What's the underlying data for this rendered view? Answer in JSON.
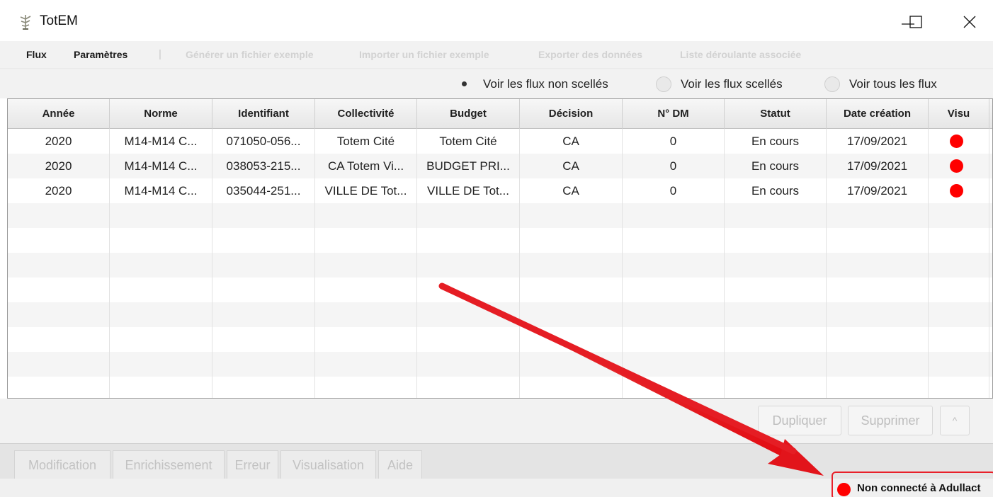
{
  "window": {
    "title": "TotEM",
    "app_icon": "tree-icon",
    "minimize_icon": "minimize-icon",
    "maximize_icon": "maximize-icon",
    "close_icon": "close-icon"
  },
  "menubar": {
    "items": [
      {
        "label": "Flux",
        "enabled": true
      },
      {
        "label": "Paramètres",
        "enabled": true
      },
      {
        "label": "Générer un fichier exemple",
        "enabled": false
      },
      {
        "label": "Importer un fichier exemple",
        "enabled": false
      },
      {
        "label": "Exporter des données",
        "enabled": false
      },
      {
        "label": "Liste déroulante associée",
        "enabled": false
      }
    ],
    "separator": "|"
  },
  "filters": {
    "options": [
      {
        "label": "Voir les flux non scellés",
        "checked": true
      },
      {
        "label": "Voir les flux scellés",
        "checked": false
      },
      {
        "label": "Voir tous les flux",
        "checked": false
      }
    ]
  },
  "table": {
    "columns": [
      "Année",
      "Norme",
      "Identifiant",
      "Collectivité",
      "Budget",
      "Décision",
      "N° DM",
      "Statut",
      "Date création",
      "Visu"
    ],
    "rows": [
      [
        "2020",
        "M14-M14 C...",
        "071050-056...",
        "Totem Cité",
        "Totem Cité",
        "CA",
        "0",
        "En cours",
        "17/09/2021",
        "red-dot"
      ],
      [
        "2020",
        "M14-M14 C...",
        "038053-215...",
        "CA Totem Vi...",
        "BUDGET PRI...",
        "CA",
        "0",
        "En cours",
        "17/09/2021",
        "red-dot"
      ],
      [
        "2020",
        "M14-M14 C...",
        "035044-251...",
        "VILLE DE Tot...",
        "VILLE DE Tot...",
        "CA",
        "0",
        "En cours",
        "17/09/2021",
        "red-dot"
      ]
    ],
    "empty_rows": 8
  },
  "actions": {
    "duplicate_label": "Dupliquer",
    "delete_label": "Supprimer",
    "up_label": "^"
  },
  "tabs": [
    "Modification",
    "Enrichissement",
    "Erreur",
    "Visualisation",
    "Aide"
  ],
  "status": {
    "text": "Non connecté à Adullact",
    "indicator_color": "#ff0000",
    "highlight_color": "#e8202a"
  }
}
